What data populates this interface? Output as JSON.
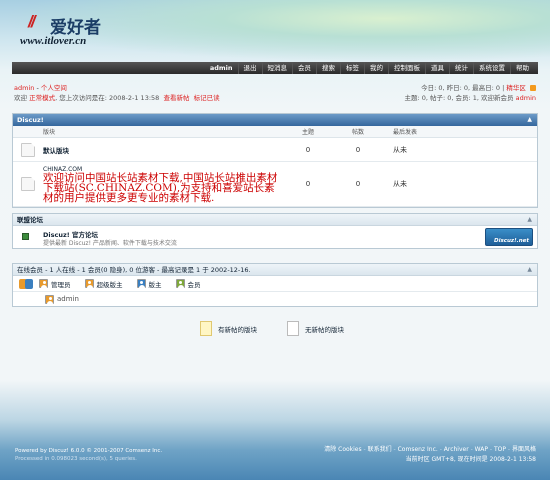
{
  "header": {
    "logo_mark": "//",
    "logo_text": "爱好者",
    "logo_url": "www.itlover.cn"
  },
  "nav": {
    "items": [
      "admin",
      "退出",
      "短消息",
      "会员",
      "搜索",
      "标签",
      "我的",
      "控制面板",
      "道具",
      "统计",
      "系统设置",
      "帮助"
    ]
  },
  "userbar": {
    "username": "admin",
    "space_link": "个人空间",
    "mode_prefix": "欢迎",
    "mode": "正常模式",
    "last_visit_label": ", 您上次访问是在:",
    "last_visit": "2008-2-1 13:58",
    "view_new": "查看新帖",
    "mark_read": "标记已读",
    "stats_line1": "今日: 0, 昨日: 0, 最高日: 0",
    "hot_label": "精华区",
    "stats_line2_prefix": "主题: 0, 帖子: 0, 会员: 1, 欢迎新会员",
    "newest_member": "admin"
  },
  "forum_panel": {
    "title": "Discuz!",
    "collapse": "▲",
    "columns": [
      "版块",
      "主题",
      "帖数",
      "最后发表"
    ],
    "rows": [
      {
        "name": "默认版块",
        "topics": "0",
        "posts": "0",
        "last": "从未"
      },
      {
        "name": "CHINAZ.COM",
        "description": "欢迎访问中国站长站素材下载,中国站长站推出素材下载站(SC.CHINAZ.COM),为支持和喜爱站长素材的用户提供更多更专业的素材下载.",
        "topics": "0",
        "posts": "0",
        "last": "从未"
      }
    ]
  },
  "alliance_panel": {
    "title": "联盟论坛",
    "collapse": "▲",
    "name": "Discuz! 官方论坛",
    "description": "提供最新 Discuz! 产品新闻、软件下载与技术交流",
    "banner": "Discuz!.net"
  },
  "online_panel": {
    "title": "在线会员 - 1 人在线 - 1 会员(0 隐身), 0 位游客 - 最高记录是 1 于 2002-12-16.",
    "collapse": "▲",
    "legend": [
      {
        "label": "管理员",
        "color": "#e89a2c"
      },
      {
        "label": "超级版主",
        "color": "#e89a2c"
      },
      {
        "label": "版主",
        "color": "#3a7fc0"
      },
      {
        "label": "会员",
        "color": "#7fa83a"
      }
    ],
    "online_user": "admin"
  },
  "legend2": {
    "new_label": "有新帖的版块",
    "old_label": "无新帖的版块"
  },
  "footer": {
    "powered": "Powered by Discuz! 6.0.0 © 2001-2007 Comsenz Inc.",
    "processed": "Processed in 0.098023 second(s), 5 queries.",
    "links": [
      "清除 Cookies",
      "联系我们",
      "Comsenz Inc.",
      "Archiver",
      "WAP",
      "TOP",
      "界面风格"
    ],
    "time_line": "当前时区 GMT+8, 现在时间是 2008-2-1 13:58"
  },
  "colors": {
    "accent_red": "#d22",
    "nav_bg": "#2a2a2a",
    "panel_head": "#35679d"
  }
}
